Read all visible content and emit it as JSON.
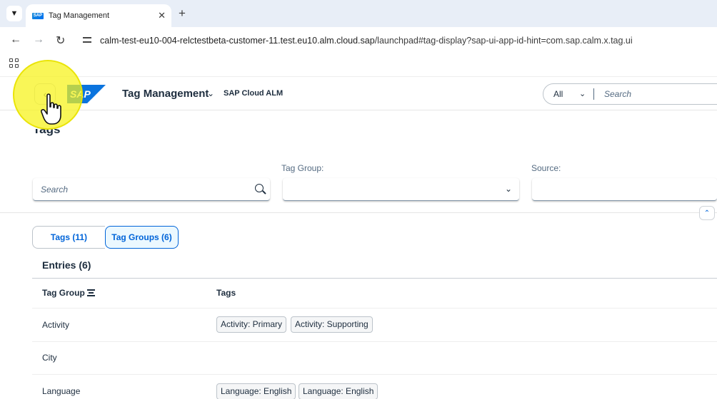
{
  "browser": {
    "tab_title": "Tag Management",
    "tab_close": "✕",
    "new_tab": "+",
    "url_host": "calm-test-eu10-004-relctestbeta-customer-11.test.eu10.alm.cloud.sap",
    "url_path": "/launchpad#tag-display?sap-ui-app-id-hint=com.sap.calm.x.tag.ui"
  },
  "shell": {
    "logo_text": "SAP",
    "app_title": "Tag Management",
    "product": "SAP Cloud ALM",
    "search_scope": "All",
    "search_placeholder": "Search"
  },
  "page": {
    "title": "Tags",
    "search_placeholder": "Search",
    "tag_group_label": "Tag Group:",
    "source_label": "Source:",
    "tab_tags": "Tags (11)",
    "tab_tag_groups": "Tag Groups (6)",
    "entries_title": "Entries (6)",
    "col_tag_group": "Tag Group",
    "col_tags": "Tags"
  },
  "rows": [
    {
      "group": "Activity",
      "tags": [
        "Activity: Primary",
        "Activity: Supporting"
      ]
    },
    {
      "group": "City",
      "tags": []
    },
    {
      "group": "Language",
      "tags": [
        "Language: English",
        "Language: English"
      ]
    }
  ],
  "colors": {
    "accent": "#0064d9",
    "highlight": "#f6f216",
    "sap_blue": "#0b74de"
  }
}
